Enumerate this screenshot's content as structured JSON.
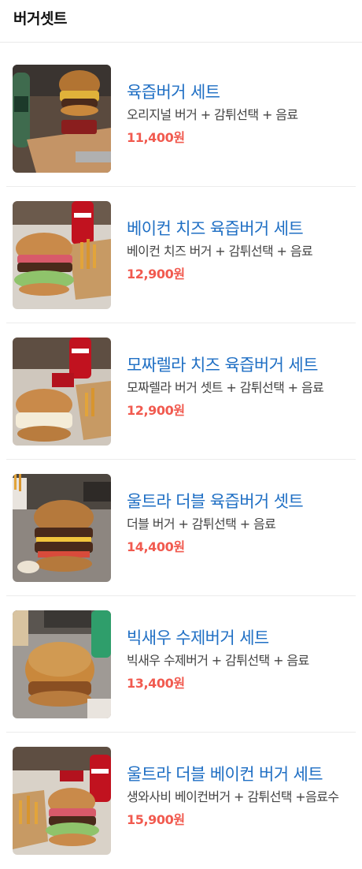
{
  "header": {
    "title": "버거셋트"
  },
  "items": [
    {
      "name": "육즙버거 세트",
      "desc": "오리지널 버거 + 감튀선택 + 음료",
      "price": "11,400원",
      "photo": "burger-set-photo"
    },
    {
      "name": "베이컨 치즈 육즙버거 세트",
      "desc": "베이컨 치즈 버거 + 감튀선택 + 음료",
      "price": "12,900원",
      "photo": "bacon-burger-set-photo"
    },
    {
      "name": "모짜렐라 치즈 육즙버거 세트",
      "desc": "모짜렐라 버거 셋트 + 감튀선택 + 음료",
      "price": "12,900원",
      "photo": "mozzarella-burger-set-photo"
    },
    {
      "name": "울트라 더블 육즙버거 셋트",
      "desc": "더블 버거 + 감튀선택 + 음료",
      "price": "14,400원",
      "photo": "double-burger-set-photo"
    },
    {
      "name": "빅새우 수제버거 세트",
      "desc": "빅새우 수제버거 + 감튀선택 + 음료",
      "price": "13,400원",
      "photo": "shrimp-burger-set-photo"
    },
    {
      "name": "울트라 더블 베이컨 버거 세트",
      "desc": "생와사비 베이컨버거 + 감튀선택 +음료수",
      "price": "15,900원",
      "photo": "ultra-bacon-burger-set-photo"
    }
  ]
}
